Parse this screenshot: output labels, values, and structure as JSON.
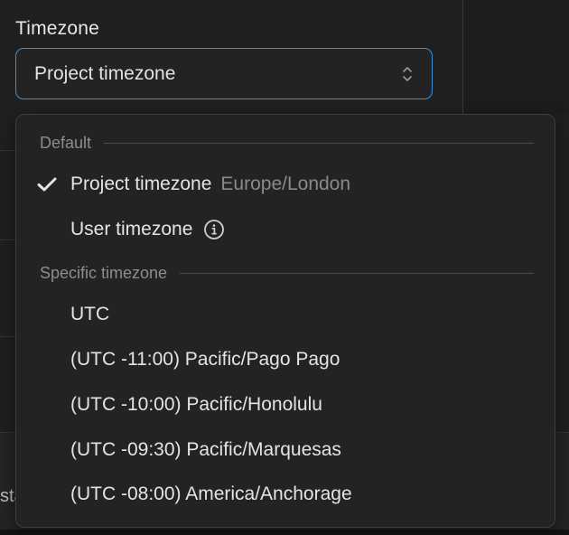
{
  "field": {
    "label": "Timezone",
    "selected_value": "Project timezone"
  },
  "dropdown": {
    "groups": [
      {
        "title": "Default",
        "options": [
          {
            "label": "Project timezone",
            "hint": "Europe/London",
            "selected": true
          },
          {
            "label": "User timezone",
            "icon": "info-icon"
          }
        ]
      },
      {
        "title": "Specific timezone",
        "options": [
          {
            "label": "UTC"
          },
          {
            "label": "(UTC -11:00) Pacific/Pago Pago"
          },
          {
            "label": "(UTC -10:00) Pacific/Honolulu"
          },
          {
            "label": "(UTC -09:30) Pacific/Marquesas"
          },
          {
            "label": "(UTC -08:00) America/Anchorage"
          }
        ]
      }
    ]
  },
  "background": {
    "cut_text": "sta"
  },
  "colors": {
    "accent_focus": "#3b8edc",
    "surface": "#232323",
    "muted_text": "#8a8a8a"
  }
}
